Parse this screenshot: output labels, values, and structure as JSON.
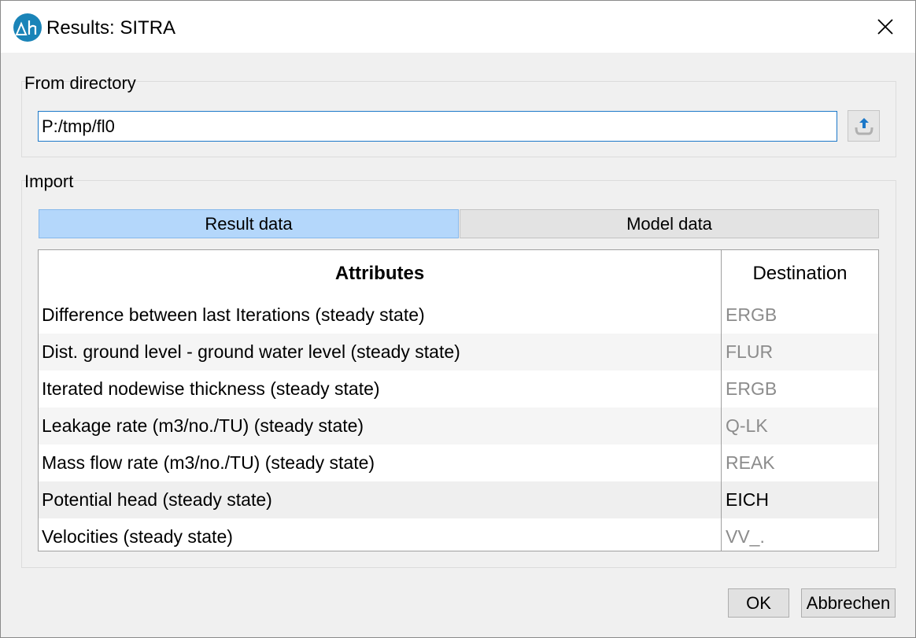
{
  "window": {
    "title": "Results: SITRA",
    "icon": "delta-h-app-icon",
    "accent_color": "#1a84b8"
  },
  "directory_group": {
    "label": "From directory",
    "path_value": "P:/tmp/fl0",
    "browse_icon": "upload-folder-icon"
  },
  "import_group": {
    "label": "Import",
    "tabs": [
      {
        "label": "Result data",
        "selected": true
      },
      {
        "label": "Model data",
        "selected": false
      }
    ],
    "selected_tab_color": "#b4d7fb",
    "table": {
      "headers": {
        "attributes": "Attributes",
        "destination": "Destination"
      },
      "rows": [
        {
          "attribute": "Difference between last Iterations (steady state)",
          "destination": "ERGB"
        },
        {
          "attribute": "Dist. ground level - ground water level (steady state)",
          "destination": "FLUR"
        },
        {
          "attribute": "Iterated nodewise thickness (steady state)",
          "destination": "ERGB"
        },
        {
          "attribute": "Leakage rate (m3/no./TU) (steady state)",
          "destination": "Q-LK"
        },
        {
          "attribute": "Mass flow rate (m3/no./TU) (steady state)",
          "destination": "REAK"
        },
        {
          "attribute": "Potential head (steady state)",
          "destination": "EICH"
        },
        {
          "attribute": "Velocities (steady state)",
          "destination": "VV_."
        }
      ]
    }
  },
  "buttons": {
    "ok": "OK",
    "cancel": "Abbrechen"
  }
}
